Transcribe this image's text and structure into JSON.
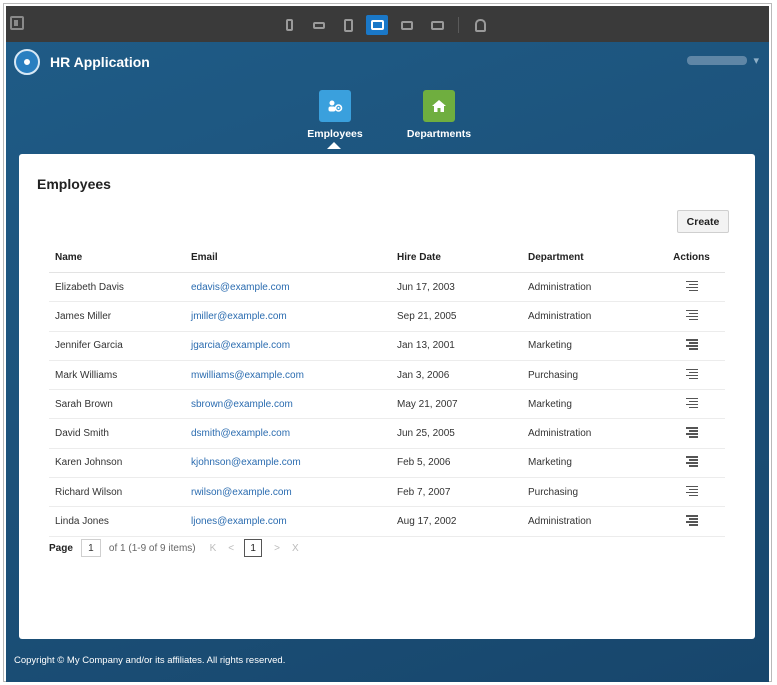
{
  "app": {
    "title": "HR Application"
  },
  "nav": [
    {
      "label": "Employees",
      "icon": "employees-icon",
      "color": "#3aa0dd"
    },
    {
      "label": "Departments",
      "icon": "home-icon",
      "color": "#6fae3f"
    }
  ],
  "page": {
    "title": "Employees",
    "create_label": "Create"
  },
  "table": {
    "headers": [
      "Name",
      "Email",
      "Hire Date",
      "Department",
      "Actions"
    ],
    "rows": [
      {
        "name": "Elizabeth Davis",
        "email": "edavis@example.com",
        "hire": "Jun 17, 2003",
        "dept": "Administration"
      },
      {
        "name": "James Miller",
        "email": "jmiller@example.com",
        "hire": "Sep 21, 2005",
        "dept": "Administration"
      },
      {
        "name": "Jennifer Garcia",
        "email": "jgarcia@example.com",
        "hire": "Jan 13, 2001",
        "dept": "Marketing"
      },
      {
        "name": "Mark Williams",
        "email": "mwilliams@example.com",
        "hire": "Jan 3, 2006",
        "dept": "Purchasing"
      },
      {
        "name": "Sarah Brown",
        "email": "sbrown@example.com",
        "hire": "May 21, 2007",
        "dept": "Marketing"
      },
      {
        "name": "David Smith",
        "email": "dsmith@example.com",
        "hire": "Jun 25, 2005",
        "dept": "Administration"
      },
      {
        "name": "Karen Johnson",
        "email": "kjohnson@example.com",
        "hire": "Feb 5, 2006",
        "dept": "Marketing"
      },
      {
        "name": "Richard Wilson",
        "email": "rwilson@example.com",
        "hire": "Feb 7, 2007",
        "dept": "Purchasing"
      },
      {
        "name": "Linda Jones",
        "email": "ljones@example.com",
        "hire": "Aug 17, 2002",
        "dept": "Administration"
      }
    ]
  },
  "pager": {
    "label": "Page",
    "page_input": "1",
    "summary": "of 1 (1-9 of 9 items)",
    "current": "1",
    "first": "K",
    "prev": "<",
    "next": ">",
    "last": "X"
  },
  "footer": {
    "text": "Copyright © My Company and/or its affiliates. All rights reserved."
  }
}
